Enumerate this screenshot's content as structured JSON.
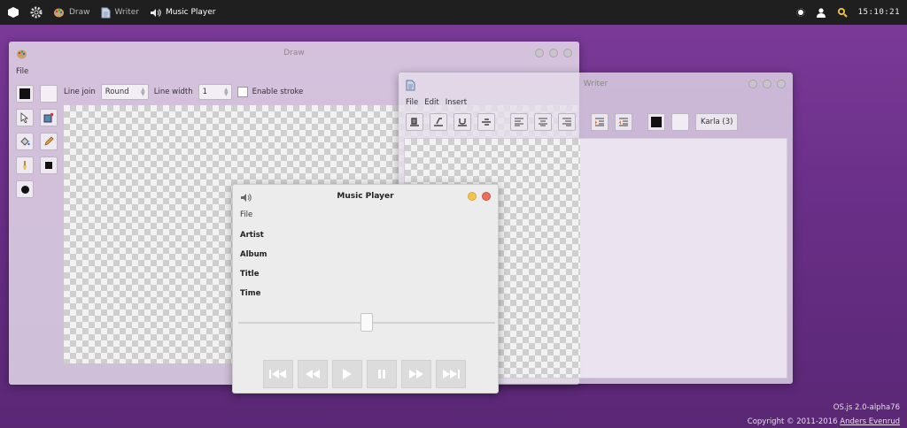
{
  "panel": {
    "items": [
      {
        "label": "Draw",
        "icon": "palette-icon"
      },
      {
        "label": "Writer",
        "icon": "document-icon"
      },
      {
        "label": "Music Player",
        "icon": "speaker-icon"
      }
    ],
    "clock": "15:10:21"
  },
  "draw": {
    "title": "Draw",
    "menu": [
      "File"
    ],
    "toolbar": {
      "line_join_label": "Line join",
      "line_join_value": "Round",
      "line_width_label": "Line width",
      "line_width_value": "1",
      "enable_stroke_label": "Enable stroke"
    }
  },
  "writer": {
    "title": "Writer",
    "menu": [
      "File",
      "Edit",
      "Insert"
    ],
    "font": "Karla (3)"
  },
  "music": {
    "title": "Music Player",
    "menu": [
      "File"
    ],
    "fields": [
      "Artist",
      "Album",
      "Title",
      "Time"
    ],
    "seek_position": 0.5
  },
  "footer": {
    "version": "OS.js 2.0-alpha76",
    "copyright_prefix": "Copyright © 2011-2016 ",
    "author": "Anders Evenrud"
  },
  "colors": {
    "desktop": "#6a2f88",
    "panel": "#1f1f1f",
    "minimize": "#f1c54b",
    "close": "#ea6e58"
  }
}
